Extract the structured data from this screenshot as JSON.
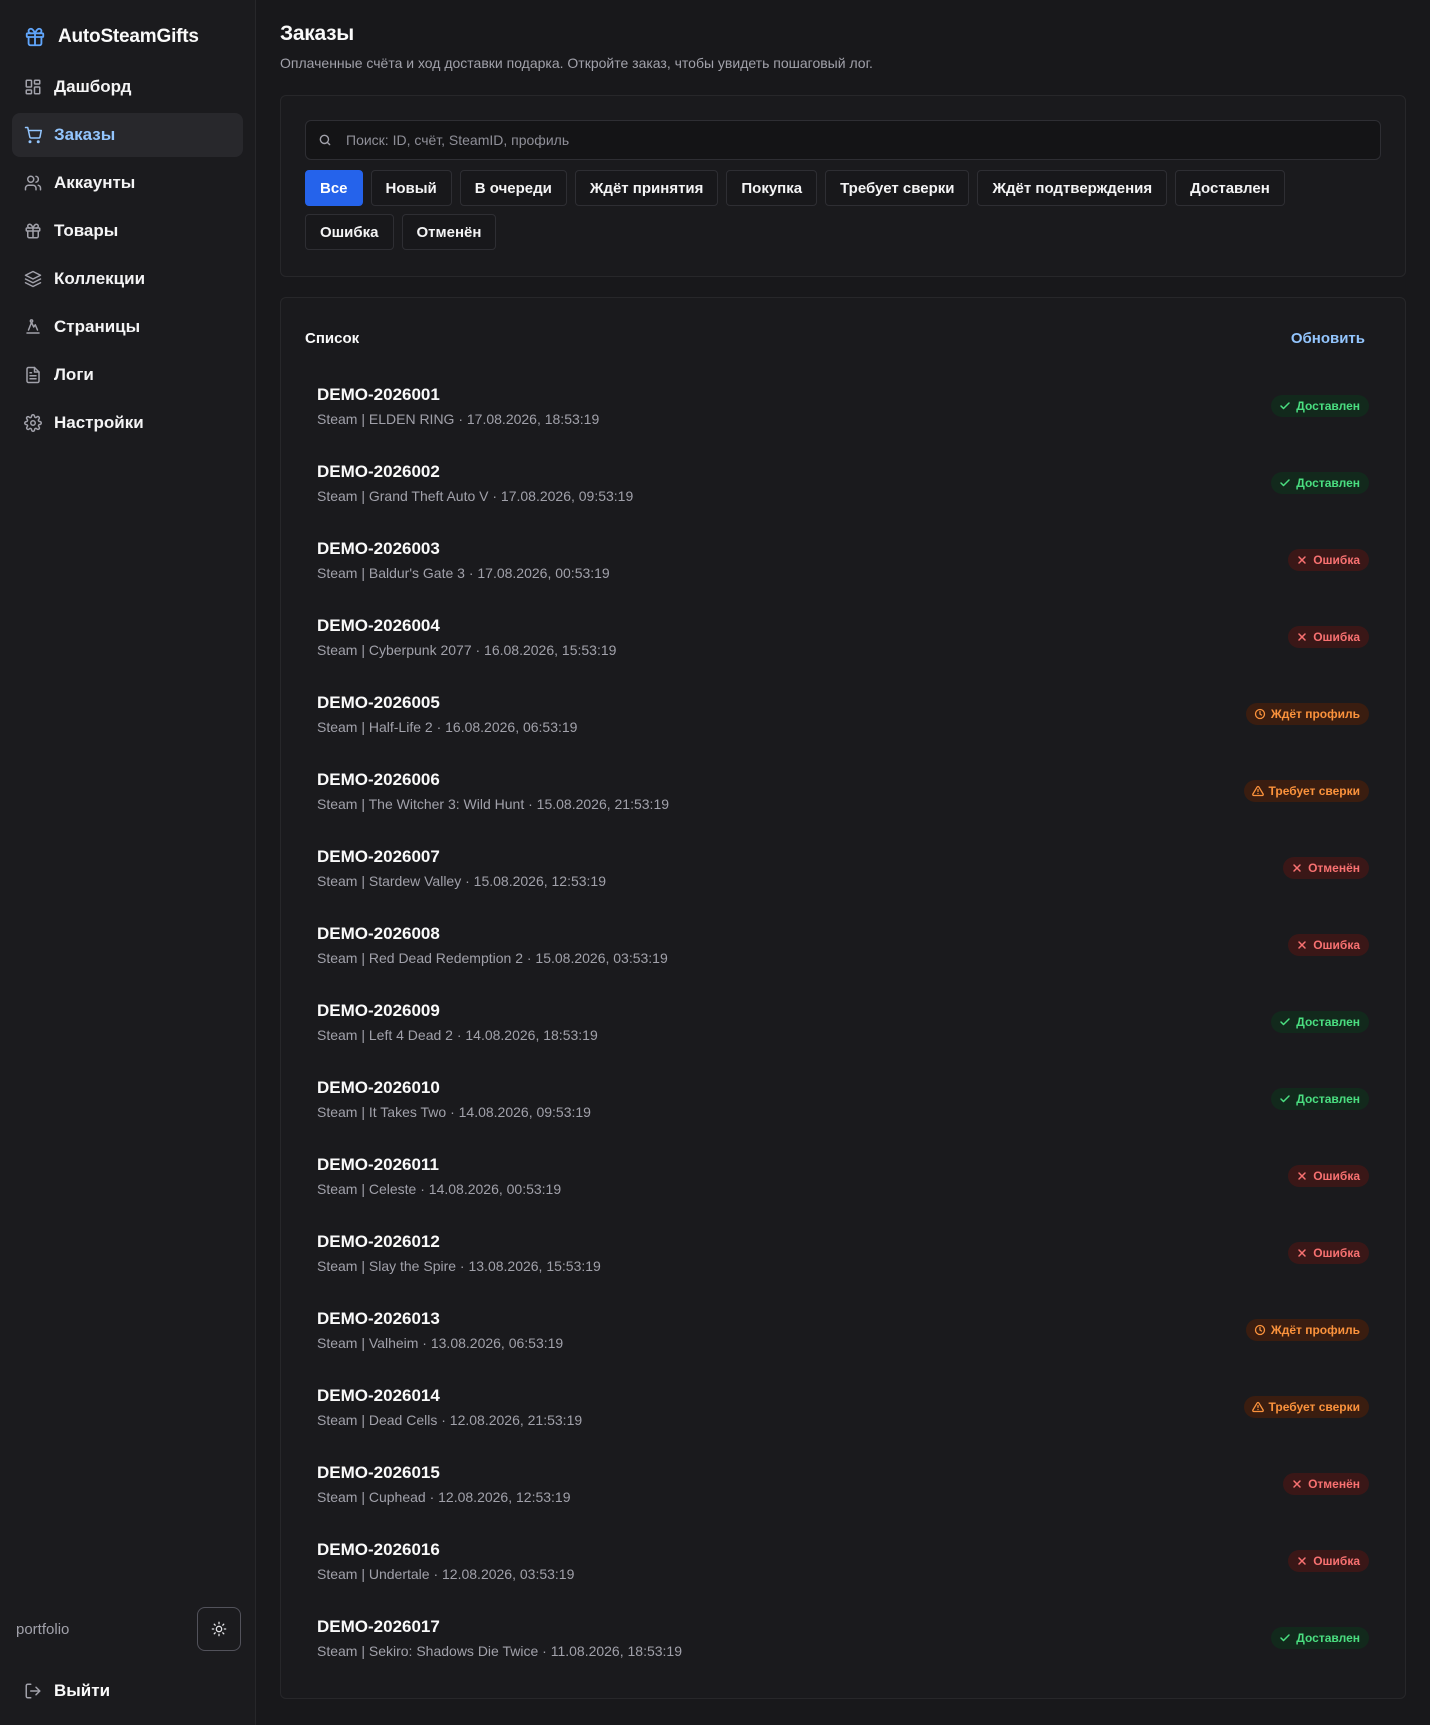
{
  "app": {
    "name": "AutoSteamGifts"
  },
  "sidebar": {
    "items": [
      {
        "label": "Дашборд",
        "icon": "dashboard-icon",
        "active": false
      },
      {
        "label": "Заказы",
        "icon": "cart-icon",
        "active": true
      },
      {
        "label": "Аккаунты",
        "icon": "users-icon",
        "active": false
      },
      {
        "label": "Товары",
        "icon": "gift-icon",
        "active": false
      },
      {
        "label": "Коллекции",
        "icon": "layers-icon",
        "active": false
      },
      {
        "label": "Страницы",
        "icon": "pages-icon",
        "active": false
      },
      {
        "label": "Логи",
        "icon": "file-icon",
        "active": false
      },
      {
        "label": "Настройки",
        "icon": "gear-icon",
        "active": false
      }
    ],
    "profile": "portfolio",
    "logout": "Выйти"
  },
  "page": {
    "title": "Заказы",
    "subtitle": "Оплаченные счёта и ход доставки подарка. Откройте заказ, чтобы увидеть пошаговый лог."
  },
  "filters": {
    "search_placeholder": "Поиск: ID, счёт, SteamID, профиль",
    "chips": [
      {
        "label": "Все",
        "active": true
      },
      {
        "label": "Новый",
        "active": false
      },
      {
        "label": "В очереди",
        "active": false
      },
      {
        "label": "Ждёт принятия",
        "active": false
      },
      {
        "label": "Покупка",
        "active": false
      },
      {
        "label": "Требует сверки",
        "active": false
      },
      {
        "label": "Ждёт подтверждения",
        "active": false
      },
      {
        "label": "Доставлен",
        "active": false
      },
      {
        "label": "Ошибка",
        "active": false
      },
      {
        "label": "Отменён",
        "active": false
      }
    ]
  },
  "list": {
    "title": "Список",
    "refresh": "Обновить",
    "orders": [
      {
        "id": "DEMO-2026001",
        "meta": "Steam | ELDEN RING · 17.08.2026, 18:53:19",
        "status": "Доставлен",
        "kind": "ok",
        "icon": "check-icon"
      },
      {
        "id": "DEMO-2026002",
        "meta": "Steam | Grand Theft Auto V · 17.08.2026, 09:53:19",
        "status": "Доставлен",
        "kind": "ok",
        "icon": "check-icon"
      },
      {
        "id": "DEMO-2026003",
        "meta": "Steam | Baldur's Gate 3 · 17.08.2026, 00:53:19",
        "status": "Ошибка",
        "kind": "err",
        "icon": "x-icon"
      },
      {
        "id": "DEMO-2026004",
        "meta": "Steam | Cyberpunk 2077 · 16.08.2026, 15:53:19",
        "status": "Ошибка",
        "kind": "err",
        "icon": "x-icon"
      },
      {
        "id": "DEMO-2026005",
        "meta": "Steam | Half-Life 2 · 16.08.2026, 06:53:19",
        "status": "Ждёт профиль",
        "kind": "warn",
        "icon": "clock-icon"
      },
      {
        "id": "DEMO-2026006",
        "meta": "Steam | The Witcher 3: Wild Hunt · 15.08.2026, 21:53:19",
        "status": "Требует сверки",
        "kind": "warn",
        "icon": "warning-icon"
      },
      {
        "id": "DEMO-2026007",
        "meta": "Steam | Stardew Valley · 15.08.2026, 12:53:19",
        "status": "Отменён",
        "kind": "err",
        "icon": "x-icon"
      },
      {
        "id": "DEMO-2026008",
        "meta": "Steam | Red Dead Redemption 2 · 15.08.2026, 03:53:19",
        "status": "Ошибка",
        "kind": "err",
        "icon": "x-icon"
      },
      {
        "id": "DEMO-2026009",
        "meta": "Steam | Left 4 Dead 2 · 14.08.2026, 18:53:19",
        "status": "Доставлен",
        "kind": "ok",
        "icon": "check-icon"
      },
      {
        "id": "DEMO-2026010",
        "meta": "Steam | It Takes Two · 14.08.2026, 09:53:19",
        "status": "Доставлен",
        "kind": "ok",
        "icon": "check-icon"
      },
      {
        "id": "DEMO-2026011",
        "meta": "Steam | Celeste · 14.08.2026, 00:53:19",
        "status": "Ошибка",
        "kind": "err",
        "icon": "x-icon"
      },
      {
        "id": "DEMO-2026012",
        "meta": "Steam | Slay the Spire · 13.08.2026, 15:53:19",
        "status": "Ошибка",
        "kind": "err",
        "icon": "x-icon"
      },
      {
        "id": "DEMO-2026013",
        "meta": "Steam | Valheim · 13.08.2026, 06:53:19",
        "status": "Ждёт профиль",
        "kind": "warn",
        "icon": "clock-icon"
      },
      {
        "id": "DEMO-2026014",
        "meta": "Steam | Dead Cells · 12.08.2026, 21:53:19",
        "status": "Требует сверки",
        "kind": "warn",
        "icon": "warning-icon"
      },
      {
        "id": "DEMO-2026015",
        "meta": "Steam | Cuphead · 12.08.2026, 12:53:19",
        "status": "Отменён",
        "kind": "err",
        "icon": "x-icon"
      },
      {
        "id": "DEMO-2026016",
        "meta": "Steam | Undertale · 12.08.2026, 03:53:19",
        "status": "Ошибка",
        "kind": "err",
        "icon": "x-icon"
      },
      {
        "id": "DEMO-2026017",
        "meta": "Steam | Sekiro: Shadows Die Twice · 11.08.2026, 18:53:19",
        "status": "Доставлен",
        "kind": "ok",
        "icon": "check-icon"
      }
    ]
  },
  "colors": {
    "accent": "#2563eb",
    "link": "#93c5fd",
    "ok": "#4ade80",
    "error": "#f87171",
    "warning": "#fb923c"
  }
}
